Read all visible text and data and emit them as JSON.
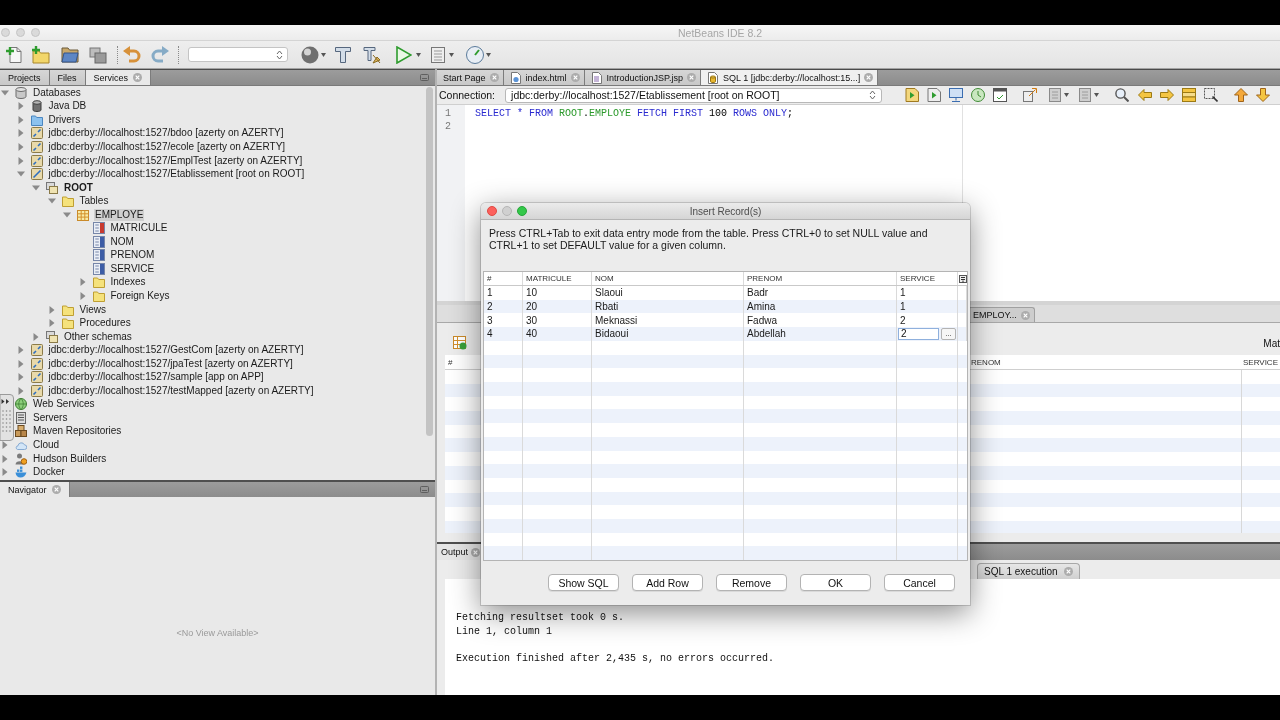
{
  "window": {
    "title": "NetBeans IDE 8.2"
  },
  "left_panel": {
    "tabs": [
      {
        "label": "Projects",
        "selected": false
      },
      {
        "label": "Files",
        "selected": false
      },
      {
        "label": "Services",
        "selected": true
      }
    ],
    "tree": [
      {
        "label": "Databases",
        "kind": "database",
        "expanded": true,
        "selected": false,
        "children": [
          {
            "label": "Java DB",
            "kind": "engine",
            "expanded": false,
            "selected": false
          },
          {
            "label": "Drivers",
            "kind": "drivers",
            "expanded": false,
            "selected": false
          },
          {
            "label": "jdbc:derby://localhost:1527/bdoo [azerty on AZERTY]",
            "kind": "connection",
            "expanded": false,
            "selected": false
          },
          {
            "label": "jdbc:derby://localhost:1527/ecole [azerty on AZERTY]",
            "kind": "connection",
            "expanded": false,
            "selected": false
          },
          {
            "label": "jdbc:derby://localhost:1527/EmplTest [azerty on AZERTY]",
            "kind": "connection",
            "expanded": false,
            "selected": false
          },
          {
            "label": "jdbc:derby://localhost:1527/Etablissement [root on ROOT]",
            "kind": "connected",
            "expanded": true,
            "selected": false,
            "children": [
              {
                "label": "ROOT",
                "kind": "schema",
                "bold": true,
                "expanded": true,
                "selected": false,
                "children": [
                  {
                    "label": "Tables",
                    "kind": "folder",
                    "expanded": true,
                    "selected": false,
                    "children": [
                      {
                        "label": "EMPLOYE",
                        "kind": "table",
                        "expanded": true,
                        "selected": true,
                        "children": [
                          {
                            "label": "MATRICULE",
                            "kind": "key",
                            "selected": false
                          },
                          {
                            "label": "NOM",
                            "kind": "column",
                            "selected": false
                          },
                          {
                            "label": "PRENOM",
                            "kind": "column",
                            "selected": false
                          },
                          {
                            "label": "SERVICE",
                            "kind": "column",
                            "selected": false
                          },
                          {
                            "label": "Indexes",
                            "kind": "folder",
                            "expanded": false,
                            "selected": false
                          },
                          {
                            "label": "Foreign Keys",
                            "kind": "folder",
                            "expanded": false,
                            "selected": false
                          }
                        ]
                      }
                    ]
                  },
                  {
                    "label": "Views",
                    "kind": "folder",
                    "expanded": false,
                    "selected": false
                  },
                  {
                    "label": "Procedures",
                    "kind": "folder",
                    "expanded": false,
                    "selected": false
                  }
                ]
              },
              {
                "label": "Other schemas",
                "kind": "schema",
                "expanded": false,
                "selected": false
              }
            ]
          },
          {
            "label": "jdbc:derby://localhost:1527/GestCom [azerty on AZERTY]",
            "kind": "connection",
            "expanded": false,
            "selected": false
          },
          {
            "label": "jdbc:derby://localhost:1527/jpaTest [azerty on AZERTY]",
            "kind": "connection",
            "expanded": false,
            "selected": false
          },
          {
            "label": "jdbc:derby://localhost:1527/sample [app on APP]",
            "kind": "connection",
            "expanded": false,
            "selected": false
          },
          {
            "label": "jdbc:derby://localhost:1527/testMapped [azerty on AZERTY]",
            "kind": "connection",
            "expanded": false,
            "selected": false
          }
        ]
      },
      {
        "label": "Web Services",
        "kind": "services",
        "selected": false
      },
      {
        "label": "Servers",
        "kind": "servers",
        "selected": false
      },
      {
        "label": "Maven Repositories",
        "kind": "repository",
        "selected": false
      },
      {
        "label": "Cloud",
        "kind": "cloud",
        "expanded": false,
        "selected": false
      },
      {
        "label": "Hudson Builders",
        "kind": "builders",
        "expanded": false,
        "selected": false
      },
      {
        "label": "Docker",
        "kind": "containers",
        "expanded": false,
        "selected": false
      }
    ]
  },
  "navigator": {
    "tab": "Navigator",
    "message": "<No View Available>"
  },
  "editor": {
    "tabs": [
      {
        "label": "Start Page",
        "kind": "page",
        "selected": false
      },
      {
        "label": "index.html",
        "kind": "html",
        "selected": false
      },
      {
        "label": "IntroductionJSP.jsp",
        "kind": "jsp",
        "selected": false
      },
      {
        "label": "SQL 1 [jdbc:derby://localhost:15...]",
        "kind": "sql",
        "selected": true
      }
    ],
    "connection": {
      "label": "Connection:",
      "value": "jdbc:derby://localhost:1527/Etablissement [root on ROOT]"
    },
    "lines": [
      {
        "number": "1",
        "tokens": [
          {
            "text": "SELECT * FROM ",
            "kind": "keyword"
          },
          {
            "text": "ROOT",
            "kind": "identifier"
          },
          {
            "text": ".",
            "kind": "plain"
          },
          {
            "text": "EMPLOYE",
            "kind": "identifier"
          },
          {
            "text": " FETCH FIRST ",
            "kind": "keyword"
          },
          {
            "text": "100",
            "kind": "number"
          },
          {
            "text": " ROWS ONLY",
            "kind": "keyword"
          },
          {
            "text": ";",
            "kind": "plain"
          }
        ]
      },
      {
        "number": "2"
      }
    ]
  },
  "results": {
    "tab": "EMPLOY...",
    "toolbar_label": "Mat",
    "columns": [
      "#",
      "RENOM",
      "SERVICE"
    ]
  },
  "output": {
    "tab": "Output",
    "subtab": "SQL 1 execution",
    "blocks": [
      [
        "Fetching resultset took 0 s.",
        "Line 1, column 1"
      ],
      [
        "Execution finished after 2,435 s, no errors occurred."
      ]
    ]
  },
  "dialog": {
    "title": "Insert Record(s)",
    "message": "Press CTRL+Tab to exit data entry mode from the table. Press CTRL+0 to set NULL value and CTRL+1 to set DEFAULT value for a given column.",
    "columns": [
      "#",
      "MATRICULE",
      "NOM",
      "PRENOM",
      "SERVICE"
    ],
    "rows": [
      [
        "1",
        "10",
        "Slaoui",
        "Badr",
        "1"
      ],
      [
        "2",
        "20",
        "Rbati",
        "Amina",
        "1"
      ],
      [
        "3",
        "30",
        "Meknassi",
        "Fadwa",
        "2"
      ],
      [
        "4",
        "40",
        "Bidaoui",
        "Abdellah",
        {
          "kind": "editor",
          "value": "2",
          "button": "..."
        }
      ]
    ],
    "buttons": [
      "Show SQL",
      "Add Row",
      "Remove",
      "OK",
      "Cancel"
    ]
  }
}
